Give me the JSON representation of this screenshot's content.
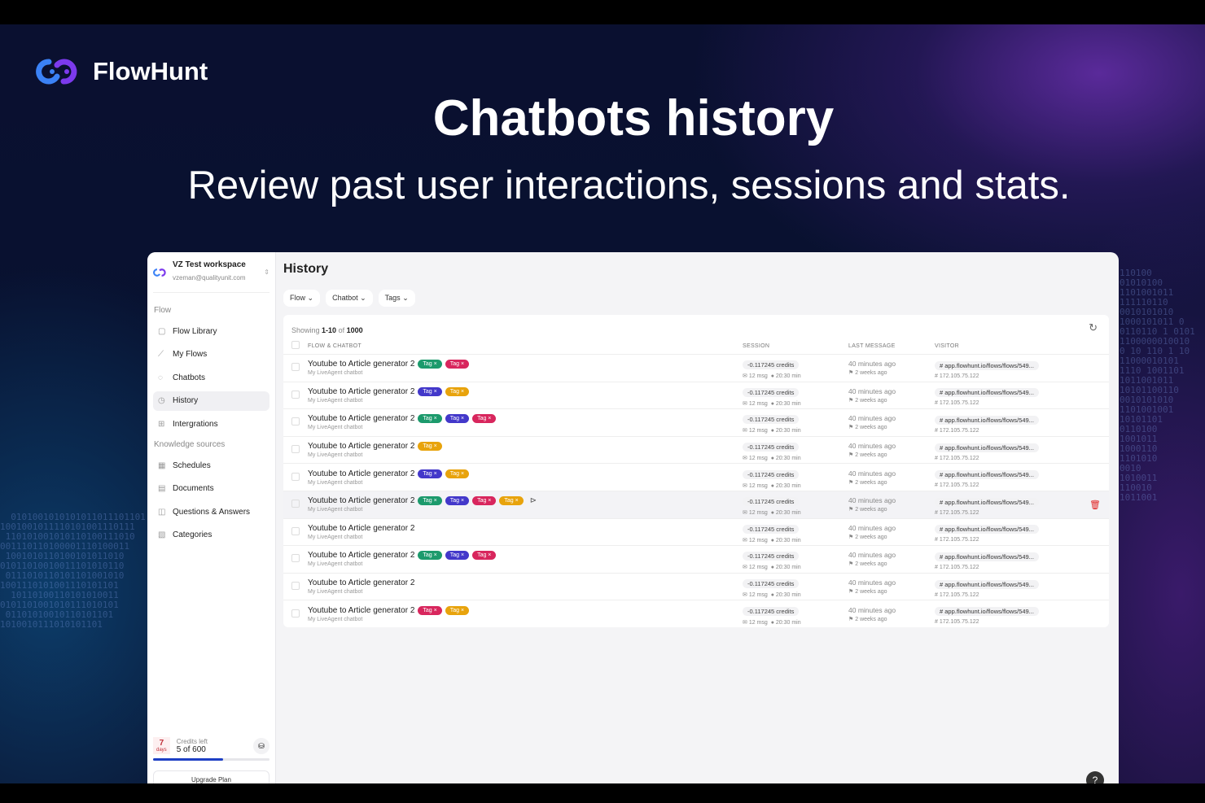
{
  "hero": {
    "brand": "FlowHunt",
    "title": "Chatbots history",
    "subtitle": "Review past user interactions, sessions and stats."
  },
  "workspace": {
    "name": "VZ Test workspace",
    "email": "vzeman@qualityunit.com"
  },
  "sidebar": {
    "section_flow": "Flow",
    "section_knowledge": "Knowledge sources",
    "flow_items": [
      {
        "label": "Flow Library",
        "icon": "▢"
      },
      {
        "label": "My Flows",
        "icon": "⟋"
      },
      {
        "label": "Chatbots",
        "icon": "◌"
      },
      {
        "label": "History",
        "icon": "◷"
      },
      {
        "label": "Intergrations",
        "icon": "⊞"
      }
    ],
    "knowledge_items": [
      {
        "label": "Schedules",
        "icon": "▦"
      },
      {
        "label": "Documents",
        "icon": "▤"
      },
      {
        "label": "Questions & Answers",
        "icon": "◫"
      },
      {
        "label": "Categories",
        "icon": "▧"
      }
    ],
    "credits": {
      "days": "7",
      "days_label": "days",
      "label": "Credits left",
      "value": "5 of 600",
      "progress": 0.6
    },
    "upgrade": "Upgrade Plan"
  },
  "page": {
    "title": "History",
    "filters": [
      "Flow",
      "Chatbot",
      "Tags"
    ],
    "showing_prefix": "Showing",
    "showing_range": "1-10",
    "showing_of": "of",
    "showing_total": "1000",
    "columns": [
      "FLOW & CHATBOT",
      "SESSION",
      "LAST MESSAGE",
      "VISITOR"
    ]
  },
  "tag_colors": {
    "green": "#1c9a6c",
    "pink": "#d8265d",
    "blue": "#4338ca",
    "yellow": "#e8a30c"
  },
  "rows": [
    {
      "flow": "Youtube to Article generator 2",
      "chatbot": "My LiveAgent chatbot",
      "tags": [
        "green",
        "pink"
      ],
      "credits": "-0.117245 credits",
      "msgs": "12 msg",
      "duration": "20:30 min",
      "last": "40 minutes ago",
      "first": "2 weeks ago",
      "url": "app.flowhunt.io/flows/flows/549...",
      "ip": "172.105.75.122"
    },
    {
      "flow": "Youtube to Article generator 2",
      "chatbot": "My LiveAgent chatbot",
      "tags": [
        "blue",
        "yellow"
      ],
      "credits": "-0.117245 credits",
      "msgs": "12 msg",
      "duration": "20:30 min",
      "last": "40 minutes ago",
      "first": "2 weeks ago",
      "url": "app.flowhunt.io/flows/flows/549...",
      "ip": "172.105.75.122"
    },
    {
      "flow": "Youtube to Article generator 2",
      "chatbot": "My LiveAgent chatbot",
      "tags": [
        "green",
        "blue",
        "pink"
      ],
      "credits": "-0.117245 credits",
      "msgs": "12 msg",
      "duration": "20:30 min",
      "last": "40 minutes ago",
      "first": "2 weeks ago",
      "url": "app.flowhunt.io/flows/flows/549...",
      "ip": "172.105.75.122"
    },
    {
      "flow": "Youtube to Article generator 2",
      "chatbot": "My LiveAgent chatbot",
      "tags": [
        "yellow"
      ],
      "credits": "-0.117245 credits",
      "msgs": "12 msg",
      "duration": "20:30 min",
      "last": "40 minutes ago",
      "first": "2 weeks ago",
      "url": "app.flowhunt.io/flows/flows/549...",
      "ip": "172.105.75.122"
    },
    {
      "flow": "Youtube to Article generator 2",
      "chatbot": "My LiveAgent chatbot",
      "tags": [
        "blue",
        "yellow"
      ],
      "credits": "-0.117245 credits",
      "msgs": "12 msg",
      "duration": "20:30 min",
      "last": "40 minutes ago",
      "first": "2 weeks ago",
      "url": "app.flowhunt.io/flows/flows/549...",
      "ip": "172.105.75.122"
    },
    {
      "flow": "Youtube to Article generator 2",
      "chatbot": "My LiveAgent chatbot",
      "tags": [
        "green",
        "blue",
        "pink",
        "yellow"
      ],
      "hover": true,
      "credits": "-0.117245 credits",
      "msgs": "12 msg",
      "duration": "20:30 min",
      "last": "40 minutes ago",
      "first": "2 weeks ago",
      "url": "app.flowhunt.io/flows/flows/549...",
      "ip": "172.105.75.122"
    },
    {
      "flow": "Youtube to Article generator 2",
      "chatbot": "My LiveAgent chatbot",
      "tags": [],
      "credits": "-0.117245 credits",
      "msgs": "12 msg",
      "duration": "20:30 min",
      "last": "40 minutes ago",
      "first": "2 weeks ago",
      "url": "app.flowhunt.io/flows/flows/549...",
      "ip": "172.105.75.122"
    },
    {
      "flow": "Youtube to Article generator 2",
      "chatbot": "My LiveAgent chatbot",
      "tags": [
        "green",
        "blue",
        "pink"
      ],
      "credits": "-0.117245 credits",
      "msgs": "12 msg",
      "duration": "20:30 min",
      "last": "40 minutes ago",
      "first": "2 weeks ago",
      "url": "app.flowhunt.io/flows/flows/549...",
      "ip": "172.105.75.122"
    },
    {
      "flow": "Youtube to Article generator 2",
      "chatbot": "My LiveAgent chatbot",
      "tags": [],
      "credits": "-0.117245 credits",
      "msgs": "12 msg",
      "duration": "20:30 min",
      "last": "40 minutes ago",
      "first": "2 weeks ago",
      "url": "app.flowhunt.io/flows/flows/549...",
      "ip": "172.105.75.122"
    },
    {
      "flow": "Youtube to Article generator 2",
      "chatbot": "My LiveAgent chatbot",
      "tags": [
        "pink",
        "yellow"
      ],
      "credits": "-0.117245 credits",
      "msgs": "12 msg",
      "duration": "20:30 min",
      "last": "40 minutes ago",
      "first": "2 weeks ago",
      "url": "app.flowhunt.io/flows/flows/549...",
      "ip": "172.105.75.122"
    }
  ],
  "tag_label": "Tag ×",
  "help": "?"
}
